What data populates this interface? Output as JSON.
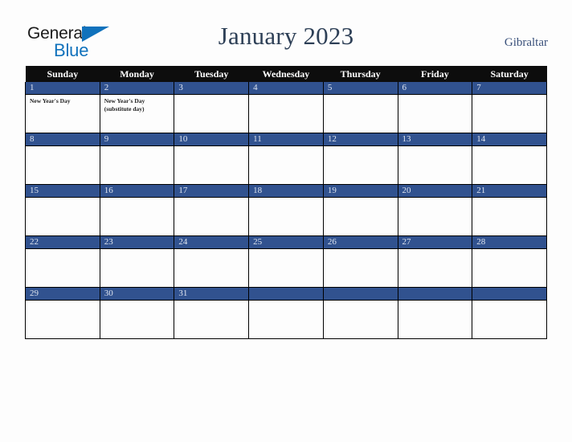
{
  "brand": {
    "line1": "General",
    "line2": "Blue",
    "triangle_color": "#1072bc",
    "text_color": "#1b1b1b"
  },
  "header": {
    "title": "January 2023",
    "country": "Gibraltar",
    "title_color": "#2e4057",
    "country_color": "#39507a"
  },
  "colors": {
    "weekday_header_bg": "#0d0d0d",
    "weekday_header_text": "#ffffff",
    "date_bar_bg": "#31528f",
    "date_bar_text": "#dfe5f0",
    "cell_bg": "#fdfdfd",
    "grid_line": "#000000",
    "page_bg": "#fdfdfd"
  },
  "weekdays": [
    "Sunday",
    "Monday",
    "Tuesday",
    "Wednesday",
    "Thursday",
    "Friday",
    "Saturday"
  ],
  "weeks": [
    [
      {
        "day": "1",
        "events": [
          "New Year's Day"
        ]
      },
      {
        "day": "2",
        "events": [
          "New Year's Day (substitute day)"
        ]
      },
      {
        "day": "3",
        "events": []
      },
      {
        "day": "4",
        "events": []
      },
      {
        "day": "5",
        "events": []
      },
      {
        "day": "6",
        "events": []
      },
      {
        "day": "7",
        "events": []
      }
    ],
    [
      {
        "day": "8",
        "events": []
      },
      {
        "day": "9",
        "events": []
      },
      {
        "day": "10",
        "events": []
      },
      {
        "day": "11",
        "events": []
      },
      {
        "day": "12",
        "events": []
      },
      {
        "day": "13",
        "events": []
      },
      {
        "day": "14",
        "events": []
      }
    ],
    [
      {
        "day": "15",
        "events": []
      },
      {
        "day": "16",
        "events": []
      },
      {
        "day": "17",
        "events": []
      },
      {
        "day": "18",
        "events": []
      },
      {
        "day": "19",
        "events": []
      },
      {
        "day": "20",
        "events": []
      },
      {
        "day": "21",
        "events": []
      }
    ],
    [
      {
        "day": "22",
        "events": []
      },
      {
        "day": "23",
        "events": []
      },
      {
        "day": "24",
        "events": []
      },
      {
        "day": "25",
        "events": []
      },
      {
        "day": "26",
        "events": []
      },
      {
        "day": "27",
        "events": []
      },
      {
        "day": "28",
        "events": []
      }
    ],
    [
      {
        "day": "29",
        "events": []
      },
      {
        "day": "30",
        "events": []
      },
      {
        "day": "31",
        "events": []
      },
      {
        "day": "",
        "events": []
      },
      {
        "day": "",
        "events": []
      },
      {
        "day": "",
        "events": []
      },
      {
        "day": "",
        "events": []
      }
    ]
  ]
}
